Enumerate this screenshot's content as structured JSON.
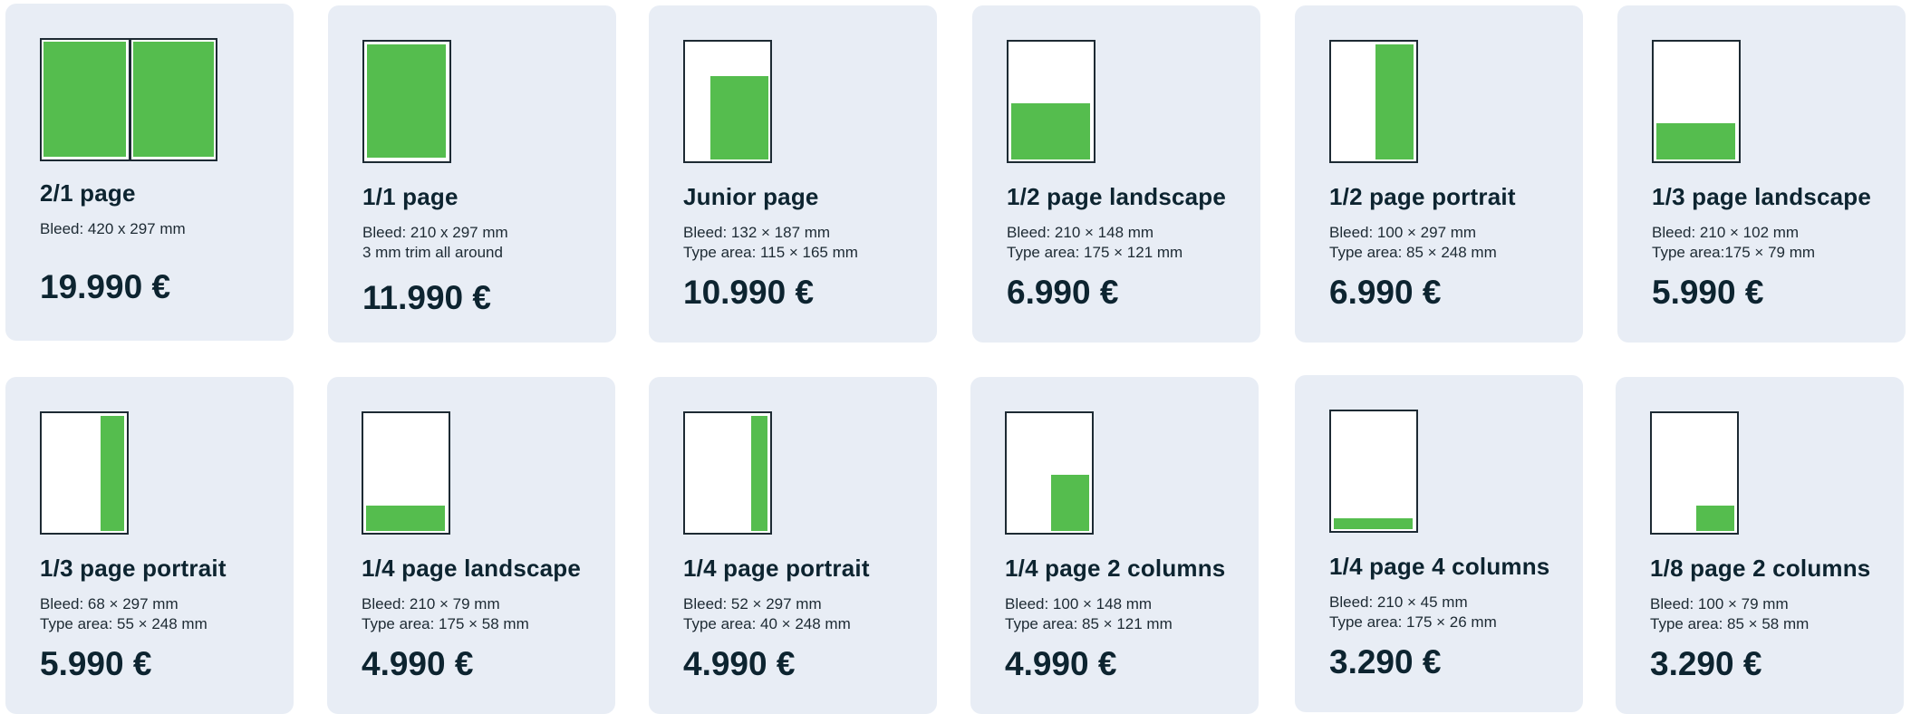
{
  "cards": [
    {
      "title": "2/1 page",
      "spec1": "Bleed: 420 x 297 mm",
      "spec2": "",
      "price": "19.990 €"
    },
    {
      "title": "1/1 page",
      "spec1": "Bleed: 210 x 297 mm",
      "spec2": "3 mm trim all around",
      "price": "11.990 €"
    },
    {
      "title": "Junior page",
      "spec1": "Bleed: 132 × 187 mm",
      "spec2": "Type area: 115 × 165 mm",
      "price": "10.990 €"
    },
    {
      "title": "1/2 page landscape",
      "spec1": "Bleed: 210 × 148 mm",
      "spec2": "Type area: 175 × 121 mm",
      "price": "6.990 €"
    },
    {
      "title": "1/2 page portrait",
      "spec1": "Bleed: 100 × 297 mm",
      "spec2": "Type area: 85 × 248 mm",
      "price": "6.990 €"
    },
    {
      "title": "1/3 page landscape",
      "spec1": "Bleed: 210 × 102 mm",
      "spec2": "Type area:175 × 79 mm",
      "price": "5.990 €"
    },
    {
      "title": "1/3 page portrait",
      "spec1": "Bleed: 68 × 297 mm",
      "spec2": "Type area: 55 × 248 mm",
      "price": "5.990 €"
    },
    {
      "title": "1/4 page landscape",
      "spec1": "Bleed: 210 × 79 mm",
      "spec2": "Type area: 175 × 58 mm",
      "price": "4.990 €"
    },
    {
      "title": "1/4 page portrait",
      "spec1": "Bleed: 52 × 297 mm",
      "spec2": "Type area: 40 × 248 mm",
      "price": "4.990 €"
    },
    {
      "title": "1/4 page 2 columns",
      "spec1": "Bleed: 100 × 148 mm",
      "spec2": "Type area: 85 × 121 mm",
      "price": "4.990 €"
    },
    {
      "title": "1/4 page 4 columns",
      "spec1": "Bleed: 210 × 45 mm",
      "spec2": "Type area: 175 × 26 mm",
      "price": "3.290 €"
    },
    {
      "title": "1/8 page 2 columns",
      "spec1": "Bleed: 100 × 79 mm",
      "spec2": "Type area: 85 × 58 mm",
      "price": "3.290 €"
    }
  ],
  "theme": {
    "card_bg": "#e8edf5",
    "accent": "#55bd4e",
    "text": "#0d2430"
  }
}
